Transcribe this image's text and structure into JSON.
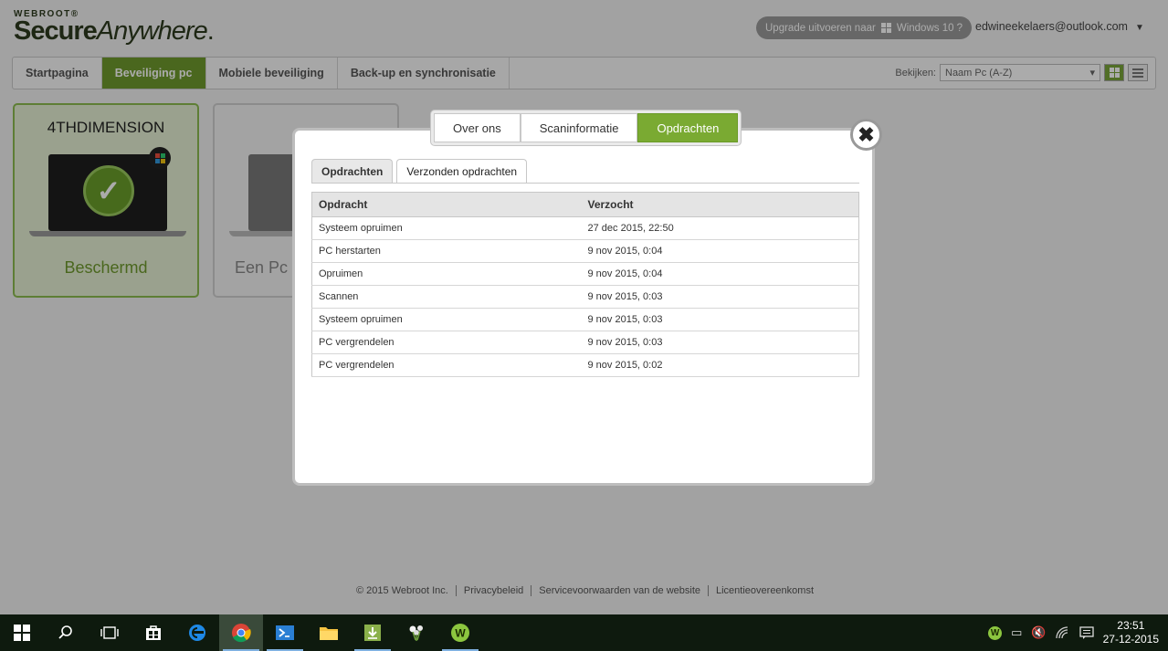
{
  "header": {
    "logo_small": "WEBROOT®",
    "logo_secure": "Secure",
    "logo_anywhere": "Anywhere",
    "logo_mark": ".",
    "upgrade_text": "Upgrade uitvoeren naar",
    "upgrade_windows": "Windows 10 ?",
    "user_email": "edwineekelaers@outlook.com"
  },
  "nav": {
    "tabs": [
      "Startpagina",
      "Beveiliging pc",
      "Mobiele beveiliging",
      "Back-up en synchronisatie"
    ],
    "active_index": 1,
    "view_label": "Bekijken:",
    "view_select": "Naam Pc (A-Z)"
  },
  "devices": [
    {
      "name": "4THDIMENSION",
      "status": "Beschermd"
    },
    {
      "name": "",
      "status": "Een Pc"
    }
  ],
  "modal": {
    "tabs": [
      "Over ons",
      "Scaninformatie",
      "Opdrachten"
    ],
    "active_tab": 2,
    "close": "✖",
    "subtabs": [
      "Opdrachten",
      "Verzonden opdrachten"
    ],
    "active_subtab": 1,
    "table": {
      "headers": [
        "Opdracht",
        "Verzocht"
      ],
      "rows": [
        [
          "Systeem opruimen",
          "27 dec 2015, 22:50"
        ],
        [
          "PC herstarten",
          "9 nov 2015, 0:04"
        ],
        [
          "Opruimen",
          "9 nov 2015, 0:04"
        ],
        [
          "Scannen",
          "9 nov 2015, 0:03"
        ],
        [
          "Systeem opruimen",
          "9 nov 2015, 0:03"
        ],
        [
          "PC vergrendelen",
          "9 nov 2015, 0:03"
        ],
        [
          "PC vergrendelen",
          "9 nov 2015, 0:02"
        ]
      ]
    }
  },
  "footer": {
    "copyright": "© 2015 Webroot Inc.",
    "links": [
      "Privacybeleid",
      "Servicevoorwaarden van de website",
      "Licentieovereenkomst"
    ]
  },
  "taskbar": {
    "time": "23:51",
    "date": "27-12-2015"
  },
  "colors": {
    "accent": "#7aaa32",
    "brand_dark": "#2e3b1f"
  }
}
